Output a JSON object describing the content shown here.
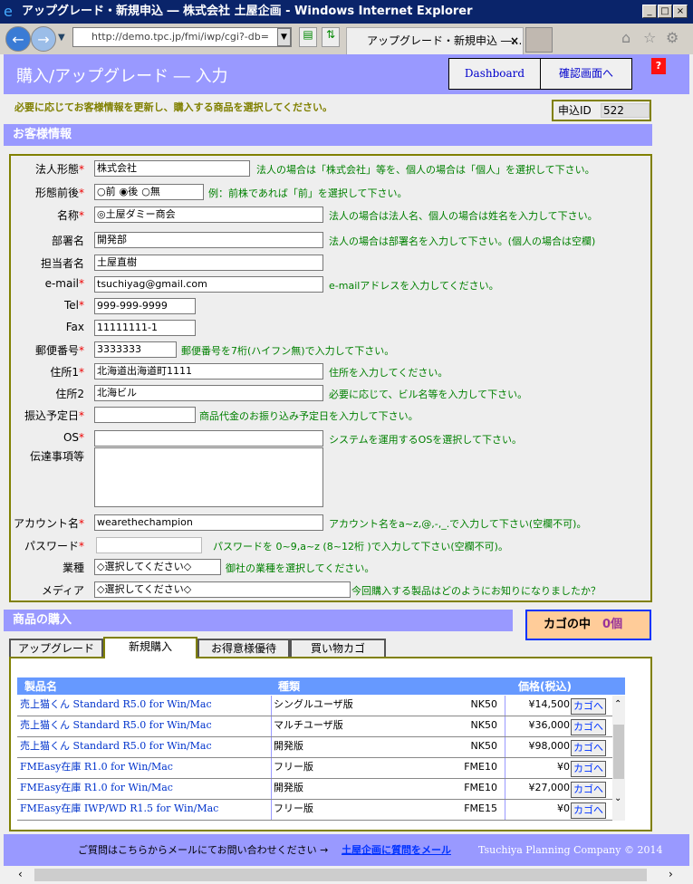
{
  "window": {
    "title": "アップグレード・新規申込 ― 株式会社 土屋企画 - Windows Internet Explorer",
    "address": "http://demo.tpc.jp/fmi/iwp/cgi?-db=",
    "tab_title": "アップグレード・新規申込 ―..."
  },
  "header": {
    "title": "購入/アップグレード ― 入力",
    "dashboard": "Dashboard",
    "confirm": "確認画面へ",
    "help": "?"
  },
  "instruction": "必要に応じてお客様情報を更新し、購入する商品を選択してください。",
  "application_id": {
    "label": "申込ID",
    "value": "522"
  },
  "customer": {
    "section_title": "お客様情報",
    "corp_type": {
      "label": "法人形態",
      "value": "株式会社",
      "hint": "法人の場合は「株式会社」等を、個人の場合は「個人」を選択して下さい。"
    },
    "position": {
      "label": "形態前後",
      "options": [
        "前",
        "後",
        "無"
      ],
      "selected": "後",
      "hint": "例：前株であれば「前」を選択して下さい。"
    },
    "name": {
      "label": "名称",
      "value": "◎土屋ダミー商会",
      "hint": "法人の場合は法人名、個人の場合は姓名を入力して下さい。"
    },
    "dept": {
      "label": "部署名",
      "value": "開発部",
      "hint": "法人の場合は部署名を入力して下さい。(個人の場合は空欄)"
    },
    "person": {
      "label": "担当者名",
      "value": "土屋直樹"
    },
    "email": {
      "label": "e-mail",
      "value": "tsuchiyag@gmail.com",
      "hint": "e-mailアドレスを入力してください。"
    },
    "tel": {
      "label": "Tel",
      "value": "999-999-9999"
    },
    "fax": {
      "label": "Fax",
      "value": "11111111-1"
    },
    "zip": {
      "label": "郵便番号",
      "value": "3333333",
      "hint": "郵便番号を7桁(ハイフン無)で入力して下さい。"
    },
    "addr1": {
      "label": "住所1",
      "value": "北海道出海道町1111",
      "hint": "住所を入力してください。"
    },
    "addr2": {
      "label": "住所2",
      "value": "北海ビル",
      "hint": "必要に応じて、ビル名等を入力して下さい。"
    },
    "pay_date": {
      "label": "振込予定日",
      "value": "",
      "hint": "商品代金のお振り込み予定日を入力して下さい。"
    },
    "os": {
      "label": "OS",
      "value": "",
      "hint": "システムを運用するOSを選択して下さい。"
    },
    "notes": {
      "label": "伝達事項等",
      "value": ""
    },
    "account": {
      "label": "アカウント名",
      "value": "wearethechampion",
      "hint": "アカウント名をa~z,@,-,_.で入力して下さい(空欄不可)。"
    },
    "password": {
      "label": "パスワード",
      "value": "",
      "hint": "パスワードを 0~9,a~z (8~12桁 )で入力して下さい(空欄不可)。"
    },
    "industry": {
      "label": "業種",
      "value": "◇選択してください◇",
      "hint": "御社の業種を選択してください。"
    },
    "media": {
      "label": "メディア",
      "value": "◇選択してください◇",
      "hint": "今回購入する製品はどのようにお知りになりましたか？"
    }
  },
  "products": {
    "section_title": "商品の購入",
    "cart_label": "カゴの中",
    "cart_count": "0個",
    "tabs": [
      "アップグレード",
      "新規購入",
      "お得意様優待",
      "買い物カゴ"
    ],
    "active_tab": "新規購入",
    "columns": [
      "製品名",
      "種類",
      "価格(税込)"
    ],
    "add_label": "カゴへ",
    "rows": [
      {
        "name": "売上猫くん Standard R5.0 for Win/Mac",
        "type": "シングルユーザ版",
        "code": "NK50",
        "price": "¥14,500"
      },
      {
        "name": "売上猫くん Standard R5.0 for Win/Mac",
        "type": "マルチユーザ版",
        "code": "NK50",
        "price": "¥36,000"
      },
      {
        "name": "売上猫くん Standard R5.0 for Win/Mac",
        "type": "開発版",
        "code": "NK50",
        "price": "¥98,000"
      },
      {
        "name": "FMEasy在庫 R1.0 for Win/Mac",
        "type": "フリー版",
        "code": "FME10",
        "price": "¥0"
      },
      {
        "name": "FMEasy在庫 R1.0 for Win/Mac",
        "type": "開発版",
        "code": "FME10",
        "price": "¥27,000"
      },
      {
        "name": "FMEasy在庫 IWP/WD R1.5 for Win/Mac",
        "type": "フリー版",
        "code": "FME15",
        "price": "¥0"
      }
    ]
  },
  "footer": {
    "text": "ご質問はこちらからメールにてお問い合わせください →",
    "link": "土屋企画に質問をメール",
    "copyright": "Tsuchiya Planning Company © 2014"
  },
  "colors": {
    "header": "#9999ff",
    "border": "#808000",
    "hint": "#008000",
    "table_header": "#6699ff",
    "cart_bg": "#ffcc99"
  }
}
